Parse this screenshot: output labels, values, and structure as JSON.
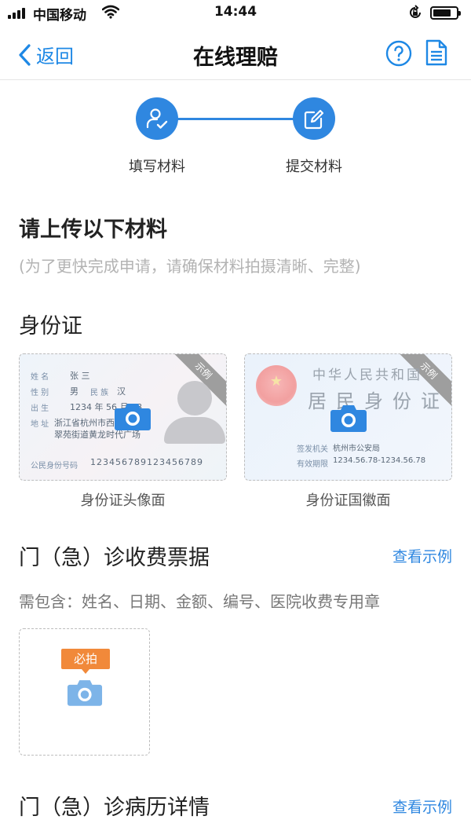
{
  "status_bar": {
    "carrier": "中国移动",
    "time": "14:44"
  },
  "nav": {
    "back_label": "返回",
    "title": "在线理赔"
  },
  "steps": [
    {
      "label": "填写材料",
      "icon": "user-check-icon"
    },
    {
      "label": "提交材料",
      "icon": "edit-icon"
    }
  ],
  "upload": {
    "title": "请上传以下材料",
    "subtitle": "(为了更快完成申请，请确保材料拍摄清晰、完整)"
  },
  "id_section": {
    "title": "身份证",
    "example_tag": "示例",
    "front": {
      "caption": "身份证头像面",
      "name_field": "姓 名",
      "name_value": "张 三",
      "gender_field": "性 别",
      "gender_value": "男",
      "ethnic_field": "民 族",
      "ethnic_value": "汉",
      "birth_field": "出 生",
      "birth_value": "1234 年 56 月 78",
      "address_field": "地 址",
      "address_line1": "浙江省杭州市西湖区",
      "address_line2": "翠苑街道黄龙时代广场",
      "id_field": "公民身份号码",
      "id_value": "123456789123456789"
    },
    "back": {
      "caption": "身份证国徽面",
      "title_line1": "中华人民共和国",
      "title_line2": "居民身份证",
      "authority_field": "签发机关",
      "authority_value": "杭州市公安局",
      "validity_field": "有效期限",
      "validity_value": "1234.56.78-1234.56.78"
    }
  },
  "receipt_section": {
    "title": "门（急）诊收费票据",
    "example_link": "查看示例",
    "requirement": "需包含：姓名、日期、金额、编号、医院收费专用章",
    "required_badge": "必拍"
  },
  "record_section": {
    "title": "门（急）诊病历详情",
    "example_link": "查看示例"
  },
  "colors": {
    "accent": "#2f87e0",
    "badge": "#f1893a"
  }
}
